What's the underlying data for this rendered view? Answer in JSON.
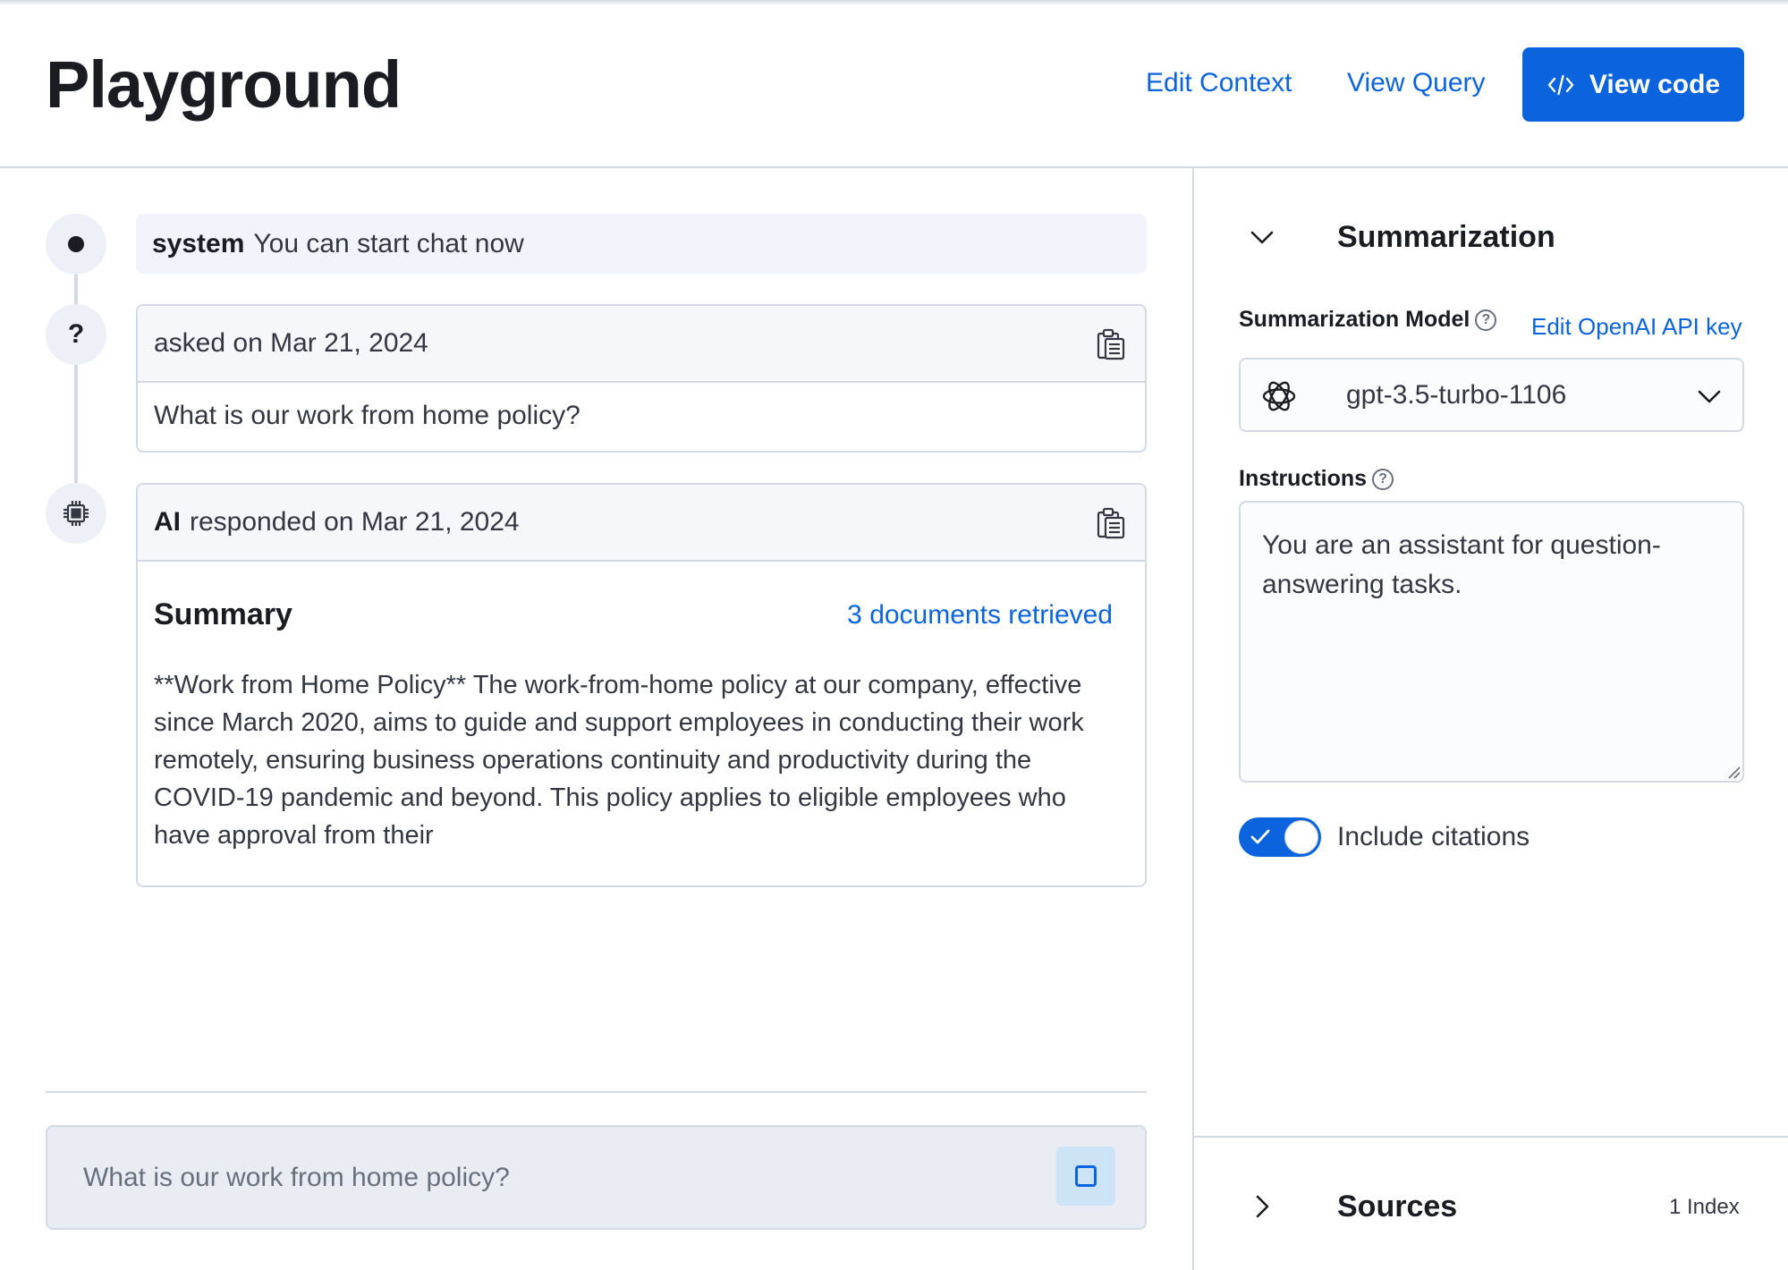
{
  "header": {
    "title": "Playground",
    "edit_context": "Edit Context",
    "view_query": "View Query",
    "view_code": "View code"
  },
  "chat": {
    "system": {
      "role": "system",
      "text": "You can start chat now"
    },
    "user_message": {
      "header": "asked on Mar 21, 2024",
      "text": "What is our work from home policy?"
    },
    "ai_message": {
      "role": "AI",
      "header": "responded on Mar 21, 2024",
      "summary_title": "Summary",
      "docs_link": "3 documents retrieved",
      "summary_text": "**Work from Home Policy** The work-from-home policy at our company, effective since March 2020, aims to guide and support employees in conducting their work remotely, ensuring business operations continuity and productivity during the COVID-19 pandemic and beyond. This policy applies to eligible employees who have approval from their"
    },
    "input": {
      "placeholder": "What is our work from home policy?"
    }
  },
  "panel": {
    "summarization": {
      "title": "Summarization",
      "model_label": "Summarization Model",
      "edit_key_link": "Edit OpenAI API key",
      "model_value": "gpt-3.5-turbo-1106",
      "instructions_label": "Instructions",
      "instructions_value": "You are an assistant for question-answering tasks.",
      "citations_label": "Include citations",
      "citations_enabled": true
    },
    "sources": {
      "title": "Sources",
      "count": "1 Index"
    }
  },
  "colors": {
    "accent": "#0b64dd",
    "border": "#d3dae6",
    "muted_bg": "#f1f4fa",
    "text": "#1a1c21"
  }
}
